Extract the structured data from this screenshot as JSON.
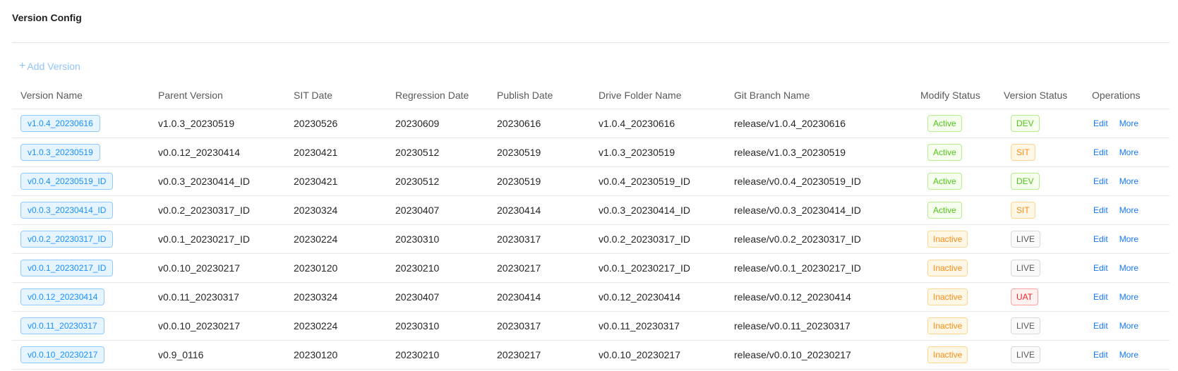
{
  "page": {
    "title": "Version Config"
  },
  "toolbar": {
    "add_label": "Add Version",
    "add_icon": "plus-icon"
  },
  "columns": [
    "Version Name",
    "Parent Version",
    "SIT Date",
    "Regression Date",
    "Publish Date",
    "Drive Folder Name",
    "Git Branch Name",
    "Modify Status",
    "Version Status",
    "Operations"
  ],
  "operations": {
    "edit_label": "Edit",
    "more_label": "More"
  },
  "rows": [
    {
      "version": "v1.0.4_20230616",
      "parent": "v1.0.3_20230519",
      "sit": "20230526",
      "regression": "20230609",
      "publish": "20230616",
      "folder": "v1.0.4_20230616",
      "branch": "release/v1.0.4_20230616",
      "modify": "Active",
      "status": "DEV"
    },
    {
      "version": "v1.0.3_20230519",
      "parent": "v0.0.12_20230414",
      "sit": "20230421",
      "regression": "20230512",
      "publish": "20230519",
      "folder": "v1.0.3_20230519",
      "branch": "release/v1.0.3_20230519",
      "modify": "Active",
      "status": "SIT"
    },
    {
      "version": "v0.0.4_20230519_ID",
      "parent": "v0.0.3_20230414_ID",
      "sit": "20230421",
      "regression": "20230512",
      "publish": "20230519",
      "folder": "v0.0.4_20230519_ID",
      "branch": "release/v0.0.4_20230519_ID",
      "modify": "Active",
      "status": "DEV"
    },
    {
      "version": "v0.0.3_20230414_ID",
      "parent": "v0.0.2_20230317_ID",
      "sit": "20230324",
      "regression": "20230407",
      "publish": "20230414",
      "folder": "v0.0.3_20230414_ID",
      "branch": "release/v0.0.3_20230414_ID",
      "modify": "Active",
      "status": "SIT"
    },
    {
      "version": "v0.0.2_20230317_ID",
      "parent": "v0.0.1_20230217_ID",
      "sit": "20230224",
      "regression": "20230310",
      "publish": "20230317",
      "folder": "v0.0.2_20230317_ID",
      "branch": "release/v0.0.2_20230317_ID",
      "modify": "Inactive",
      "status": "LIVE"
    },
    {
      "version": "v0.0.1_20230217_ID",
      "parent": "v0.0.10_20230217",
      "sit": "20230120",
      "regression": "20230210",
      "publish": "20230217",
      "folder": "v0.0.1_20230217_ID",
      "branch": "release/v0.0.1_20230217_ID",
      "modify": "Inactive",
      "status": "LIVE"
    },
    {
      "version": "v0.0.12_20230414",
      "parent": "v0.0.11_20230317",
      "sit": "20230324",
      "regression": "20230407",
      "publish": "20230414",
      "folder": "v0.0.12_20230414",
      "branch": "release/v0.0.12_20230414",
      "modify": "Inactive",
      "status": "UAT"
    },
    {
      "version": "v0.0.11_20230317",
      "parent": "v0.0.10_20230217",
      "sit": "20230224",
      "regression": "20230310",
      "publish": "20230317",
      "folder": "v0.0.11_20230317",
      "branch": "release/v0.0.11_20230317",
      "modify": "Inactive",
      "status": "LIVE"
    },
    {
      "version": "v0.0.10_20230217",
      "parent": "v0.9_0116",
      "sit": "20230120",
      "regression": "20230210",
      "publish": "20230217",
      "folder": "v0.0.10_20230217",
      "branch": "release/v0.0.10_20230217",
      "modify": "Inactive",
      "status": "LIVE"
    }
  ]
}
